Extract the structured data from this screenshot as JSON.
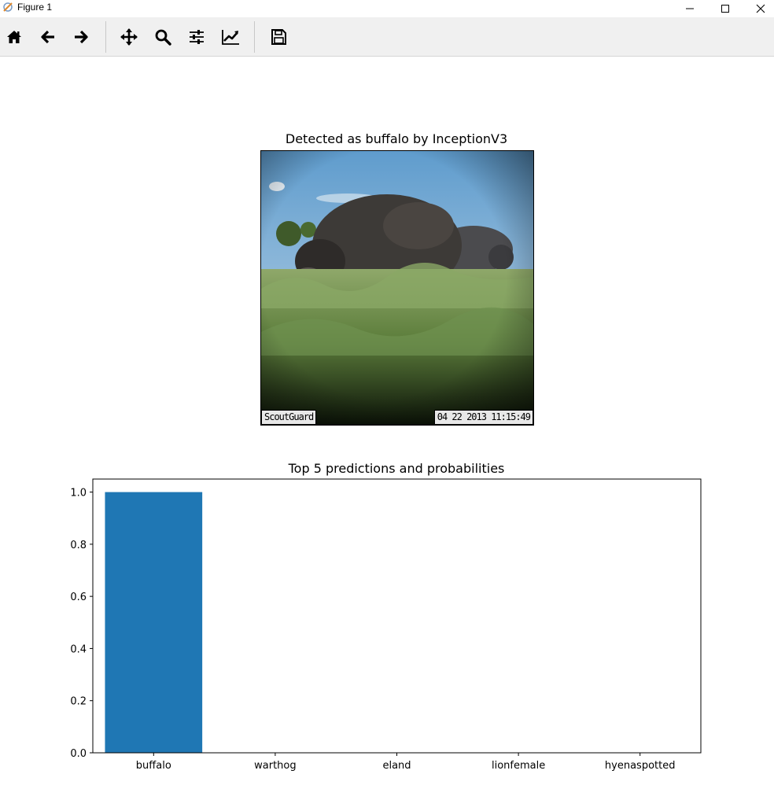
{
  "window": {
    "title": "Figure 1",
    "icons": [
      "app-icon",
      "minimize-icon",
      "maximize-icon",
      "close-icon"
    ]
  },
  "toolbar": {
    "icons": [
      "home-icon",
      "back-arrow-icon",
      "forward-arrow-icon",
      "pan-icon",
      "zoom-icon",
      "configure-subplots-icon",
      "edit-axis-icon",
      "save-icon"
    ]
  },
  "image_panel": {
    "title": "Detected as buffalo by InceptionV3",
    "stamp_left": "ScoutGuard",
    "stamp_right": "04 22 2013 11:15:49"
  },
  "chart_data": {
    "type": "bar",
    "title": "Top 5 predictions and probabilities",
    "categories": [
      "buffalo",
      "warthog",
      "eland",
      "lionfemale",
      "hyenaspotted"
    ],
    "values": [
      1.0,
      0.0,
      0.0,
      0.0,
      0.0
    ],
    "ylim": [
      0.0,
      1.05
    ],
    "yticks": [
      "0.0",
      "0.2",
      "0.4",
      "0.6",
      "0.8",
      "1.0"
    ],
    "bar_color": "#1f77b4",
    "grid": false,
    "xlabel": "",
    "ylabel": ""
  }
}
